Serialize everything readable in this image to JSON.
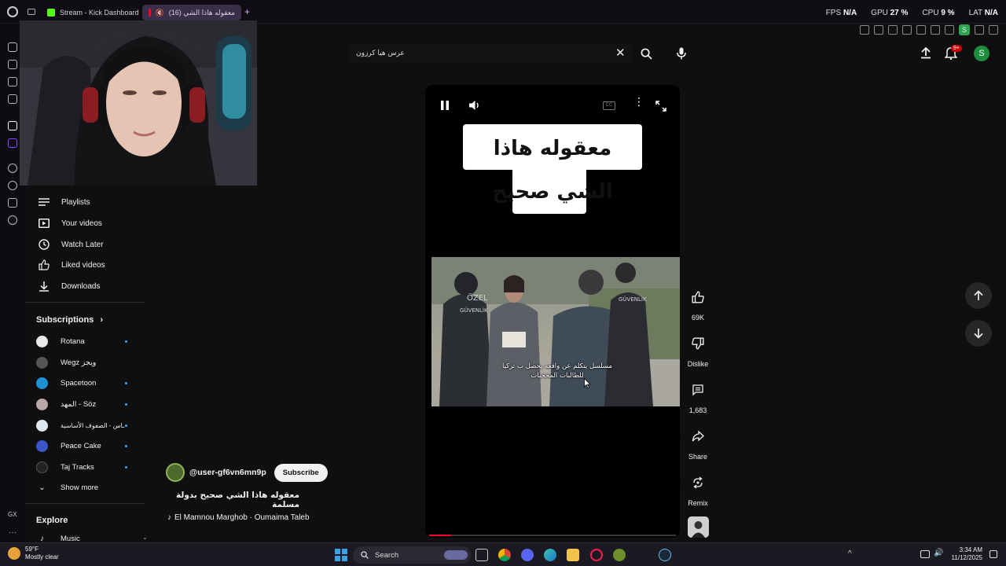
{
  "browser": {
    "tabs": [
      {
        "label": "Stream - Kick Dashboard"
      },
      {
        "label": "معقوله هاذا الشي (16)"
      }
    ],
    "stats": [
      {
        "name": "FPS",
        "value": "N/A"
      },
      {
        "name": "GPU",
        "value": "27 %"
      },
      {
        "name": "CPU",
        "value": "9 %"
      },
      {
        "name": "LAT",
        "value": "N/A"
      }
    ],
    "profile_initial": "S"
  },
  "header": {
    "search": {
      "value": "عرس هيا كرزون"
    },
    "notification_badge": "9+",
    "avatar_initial": "S"
  },
  "sidebar": {
    "you_items": [
      {
        "label": "Playlists",
        "icon": "playlists-icon"
      },
      {
        "label": "Your videos",
        "icon": "your-videos-icon"
      },
      {
        "label": "Watch Later",
        "icon": "clock-icon"
      },
      {
        "label": "Liked videos",
        "icon": "thumb-up-icon"
      },
      {
        "label": "Downloads",
        "icon": "download-icon"
      }
    ],
    "subscriptions_title": "Subscriptions",
    "subscriptions": [
      {
        "label": "Rotana",
        "color": "#e8e8e8"
      },
      {
        "label": "Wegz ويجز",
        "color": "#555555"
      },
      {
        "label": "Spacetoon",
        "color": "#1e90d6"
      },
      {
        "label": "المهد - Söz",
        "color": "#b9a8a8"
      },
      {
        "label": "ـاس - الصفوف الأساسية",
        "color": "#dfe7ef"
      },
      {
        "label": "Peace Cake",
        "color": "#3a56c7"
      },
      {
        "label": "Taj Tracks",
        "color": "#222222"
      }
    ],
    "show_more": "Show more",
    "explore_title": "Explore",
    "explore_items": [
      {
        "label": "Music"
      }
    ]
  },
  "video": {
    "caption": "معقوله هاذا الشي صحيح",
    "subtitle": "مسلسل يتكلم عن واقعه يحصل ب تركيا للطالبات المحجبات",
    "progress": 0.09
  },
  "meta": {
    "channel": "@user-gf6vn6mn9p",
    "subscribe": "Subscribe",
    "title": "معقوله هاذا الشي صحيح بدولة مسلمة",
    "music": "El Mamnou Marghob · Oumaima Taleb"
  },
  "actions": {
    "likes": "69K",
    "dislike": "Dislike",
    "comments": "1,683",
    "share": "Share",
    "remix": "Remix"
  },
  "taskbar": {
    "weather_temp": "59°F",
    "weather_desc": "Mostly clear",
    "search_label": "Search",
    "time": "3:34 AM",
    "date": "11/12/2025",
    "gx_label": "GX"
  }
}
